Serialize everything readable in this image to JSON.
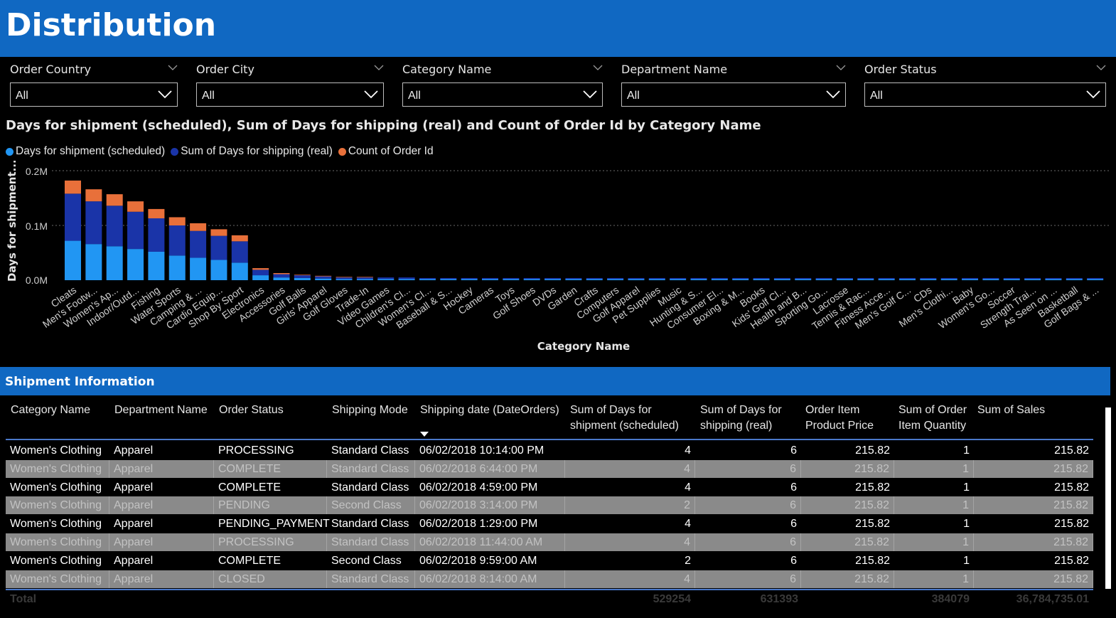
{
  "header": {
    "title": "Distribution"
  },
  "slicers": [
    {
      "label": "Order Country",
      "value": "All"
    },
    {
      "label": "Order City",
      "value": "All"
    },
    {
      "label": "Category Name",
      "value": "All"
    },
    {
      "label": "Department Name",
      "value": "All"
    },
    {
      "label": "Order Status",
      "value": "All"
    }
  ],
  "chart": {
    "title": "Days for shipment (scheduled), Sum of Days for shipping (real) and Count of Order Id by Category Name",
    "legend": [
      {
        "name": "Days for shipment (scheduled)",
        "color": "#2196f3"
      },
      {
        "name": "Sum of Days for shipping (real)",
        "color": "#1a34a8"
      },
      {
        "name": "Count of Order Id",
        "color": "#e8703a"
      }
    ],
    "ylabel": "Days for shipment...",
    "xlabel": "Category Name",
    "yticks": [
      "0.2M",
      "0.1M",
      "0.0M"
    ]
  },
  "chart_data": {
    "type": "bar",
    "stacked": true,
    "title": "Days for shipment (scheduled), Sum of Days for shipping (real) and Count of Order Id by Category Name",
    "xlabel": "Category Name",
    "ylabel": "Days for shipment...",
    "ylim": [
      0,
      0.2
    ],
    "y_unit": "M",
    "grid": true,
    "legend_position": "top-left",
    "categories": [
      "Cleats",
      "Men's Footw...",
      "Women's Ap...",
      "Indoor/Outd...",
      "Fishing",
      "Water Sports",
      "Camping & ...",
      "Cardio Equip...",
      "Shop By Sport",
      "Electronics",
      "Accessories",
      "Golf Balls",
      "Girls' Apparel",
      "Golf Gloves",
      "Trade-In",
      "Video Games",
      "Children's Cl...",
      "Women's Cl...",
      "Baseball & S...",
      "Hockey",
      "Cameras",
      "Toys",
      "Golf Shoes",
      "DVDs",
      "Garden",
      "Crafts",
      "Computers",
      "Golf Apparel",
      "Pet Supplies",
      "Music",
      "Hunting & S...",
      "Consumer El...",
      "Boxing & M...",
      "Books",
      "Kids' Golf Cl...",
      "Health and B...",
      "Sporting Go...",
      "Lacrosse",
      "Tennis & Rac...",
      "Fitness Acce...",
      "Men's Golf C...",
      "CDs",
      "Men's Clothi...",
      "Baby",
      "Women's Go...",
      "Soccer",
      "Strength Trai...",
      "As Seen on ...",
      "Basketball",
      "Golf Bags & ..."
    ],
    "series": [
      {
        "name": "Days for shipment (scheduled)",
        "values": [
          0.072,
          0.066,
          0.062,
          0.057,
          0.052,
          0.045,
          0.041,
          0.037,
          0.032,
          0.009,
          0.005,
          0.004,
          0.003,
          0.002,
          0.002,
          0.002,
          0.002,
          0.001,
          0.001,
          0.001,
          0.001,
          0.001,
          0.001,
          0.001,
          0.001,
          0.001,
          0.001,
          0.001,
          0.001,
          0.001,
          0.001,
          0.001,
          0.001,
          0.001,
          0.001,
          0.001,
          0.001,
          0.001,
          0.001,
          0.001,
          0.001,
          0.001,
          0.001,
          0.001,
          0.001,
          0.001,
          0.001,
          0.001,
          0.001,
          0.001
        ]
      },
      {
        "name": "Sum of Days for shipping (real)",
        "values": [
          0.086,
          0.078,
          0.074,
          0.068,
          0.061,
          0.055,
          0.049,
          0.044,
          0.039,
          0.01,
          0.006,
          0.005,
          0.004,
          0.003,
          0.003,
          0.003,
          0.003,
          0.002,
          0.002,
          0.002,
          0.002,
          0.002,
          0.002,
          0.002,
          0.002,
          0.002,
          0.002,
          0.002,
          0.002,
          0.002,
          0.002,
          0.002,
          0.002,
          0.002,
          0.002,
          0.002,
          0.002,
          0.002,
          0.002,
          0.002,
          0.002,
          0.002,
          0.002,
          0.002,
          0.002,
          0.002,
          0.002,
          0.002,
          0.002,
          0.002
        ]
      },
      {
        "name": "Count of Order Id",
        "values": [
          0.024,
          0.022,
          0.021,
          0.019,
          0.017,
          0.015,
          0.014,
          0.012,
          0.011,
          0.003,
          0.002,
          0.001,
          0.001,
          0.001,
          0.001,
          0,
          0,
          0,
          0,
          0,
          0,
          0,
          0,
          0,
          0,
          0,
          0,
          0,
          0,
          0,
          0,
          0,
          0,
          0,
          0,
          0,
          0,
          0,
          0,
          0,
          0,
          0,
          0,
          0,
          0,
          0,
          0,
          0,
          0,
          0
        ]
      }
    ]
  },
  "section": {
    "title": "Shipment Information"
  },
  "table": {
    "columns": [
      "Category Name",
      "Department Name",
      "Order Status",
      "Shipping Mode",
      "Shipping date (DateOrders)",
      "Sum of Days for shipment (scheduled)",
      "Sum of Days for shipping (real)",
      "Order Item Product Price",
      "Sum of Order Item Quantity",
      "Sum of Sales"
    ],
    "rows": [
      [
        "Women's Clothing",
        "Apparel",
        "PROCESSING",
        "Standard Class",
        "06/02/2018 10:14:00 PM",
        "4",
        "6",
        "215.82",
        "1",
        "215.82"
      ],
      [
        "Women's Clothing",
        "Apparel",
        "COMPLETE",
        "Standard Class",
        "06/02/2018 6:44:00 PM",
        "4",
        "6",
        "215.82",
        "1",
        "215.82"
      ],
      [
        "Women's Clothing",
        "Apparel",
        "COMPLETE",
        "Standard Class",
        "06/02/2018 4:59:00 PM",
        "4",
        "6",
        "215.82",
        "1",
        "215.82"
      ],
      [
        "Women's Clothing",
        "Apparel",
        "PENDING",
        "Second Class",
        "06/02/2018 3:14:00 PM",
        "2",
        "6",
        "215.82",
        "1",
        "215.82"
      ],
      [
        "Women's Clothing",
        "Apparel",
        "PENDING_PAYMENT",
        "Standard Class",
        "06/02/2018 1:29:00 PM",
        "4",
        "6",
        "215.82",
        "1",
        "215.82"
      ],
      [
        "Women's Clothing",
        "Apparel",
        "PROCESSING",
        "Standard Class",
        "06/02/2018 11:44:00 AM",
        "4",
        "6",
        "215.82",
        "1",
        "215.82"
      ],
      [
        "Women's Clothing",
        "Apparel",
        "COMPLETE",
        "Second Class",
        "06/02/2018 9:59:00 AM",
        "2",
        "6",
        "215.82",
        "1",
        "215.82"
      ],
      [
        "Women's Clothing",
        "Apparel",
        "CLOSED",
        "Standard Class",
        "06/02/2018 8:14:00 AM",
        "4",
        "6",
        "215.82",
        "1",
        "215.82"
      ]
    ],
    "total": {
      "label": "Total",
      "sched": "529254",
      "real": "631393",
      "qty": "384079",
      "sales": "36,784,735.01"
    }
  }
}
